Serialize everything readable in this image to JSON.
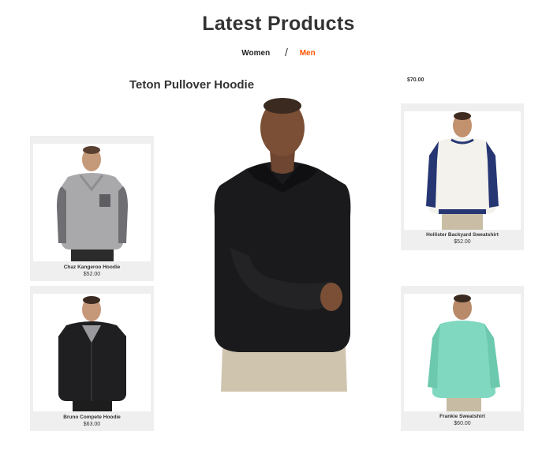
{
  "section": {
    "title": "Latest Products",
    "tabs": [
      {
        "label": "Women",
        "active": false
      },
      {
        "label": "Men",
        "active": true
      }
    ],
    "separator": "/"
  },
  "featured": {
    "name": "Teton Pullover Hoodie",
    "price": "$70.00",
    "image_icon": "black-hoodie-model-image"
  },
  "products": [
    {
      "name": "Chaz Kangeroo Hoodie",
      "price": "$52.00",
      "image_icon": "gray-hoodie-model-image"
    },
    {
      "name": "Bruno Compete Hoodie",
      "price": "$63.00",
      "image_icon": "black-zip-hoodie-model-image"
    },
    {
      "name": "Hollister Backyard Sweatshirt",
      "price": "$52.00",
      "image_icon": "raglan-sweatshirt-model-image"
    },
    {
      "name": "Frankie Sweatshirt",
      "price": "$60.00",
      "image_icon": "mint-sweatshirt-model-image"
    }
  ],
  "colors": {
    "accent": "#ff5501",
    "card_bg": "#efefef",
    "text": "#333333"
  }
}
